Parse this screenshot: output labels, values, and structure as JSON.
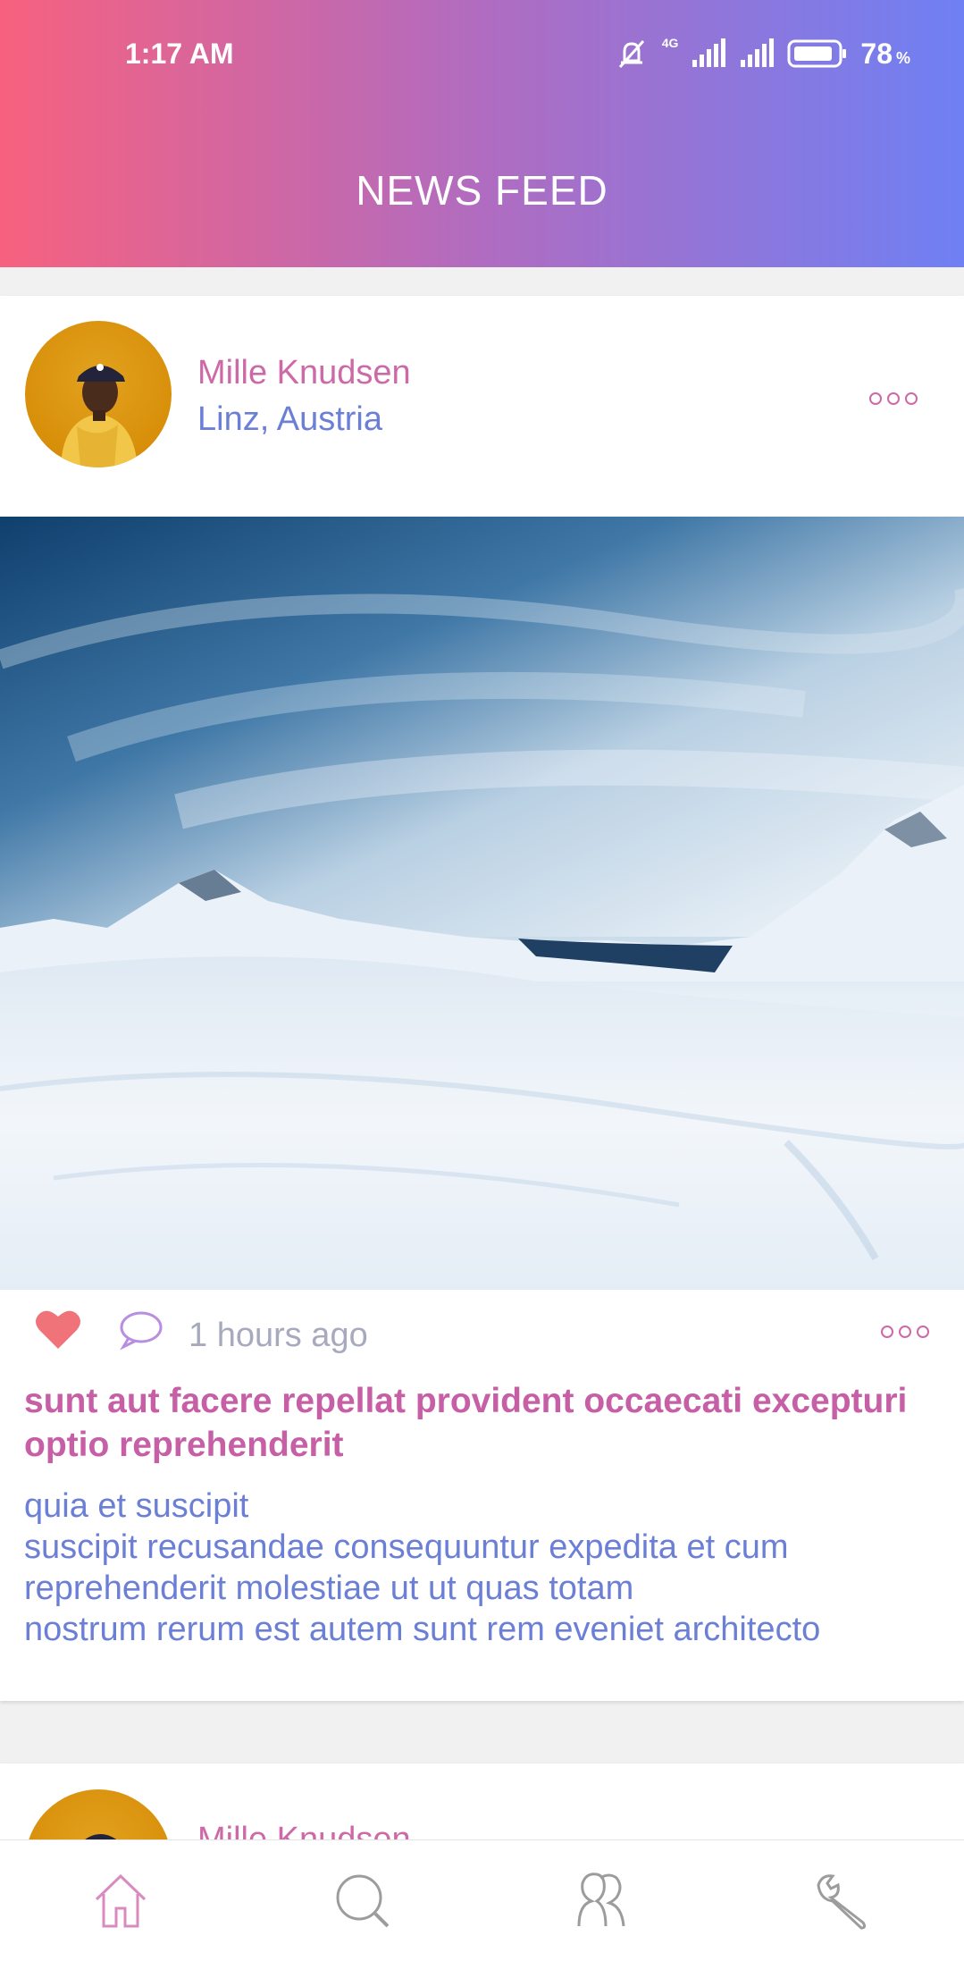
{
  "status_bar": {
    "time": "1:17 AM",
    "network": "4G",
    "battery": "78",
    "battery_unit": "%"
  },
  "header": {
    "title": "NEWS FEED"
  },
  "colors": {
    "gradient_start": "#f7617f",
    "gradient_end": "#6f80f4",
    "accent_pink": "#cd69a6",
    "accent_blue": "#6b7fd6",
    "like_red": "#f0737a"
  },
  "posts": [
    {
      "author": "Mille Knudsen",
      "location": "Linz, Austria",
      "time_ago": "1 hours ago",
      "title": "sunt aut facere repellat provident occaecati excepturi optio reprehenderit",
      "body": "quia et suscipit\nsuscipit recusandae consequuntur expedita et cum\nreprehenderit molestiae ut ut quas totam\nnostrum rerum est autem sunt rem eveniet architecto",
      "liked": true
    },
    {
      "author": "Mille Knudsen"
    }
  ],
  "bottom_nav": {
    "items": [
      {
        "icon": "home-icon",
        "active": true
      },
      {
        "icon": "search-icon",
        "active": false
      },
      {
        "icon": "people-icon",
        "active": false
      },
      {
        "icon": "wrench-icon",
        "active": false
      }
    ]
  }
}
